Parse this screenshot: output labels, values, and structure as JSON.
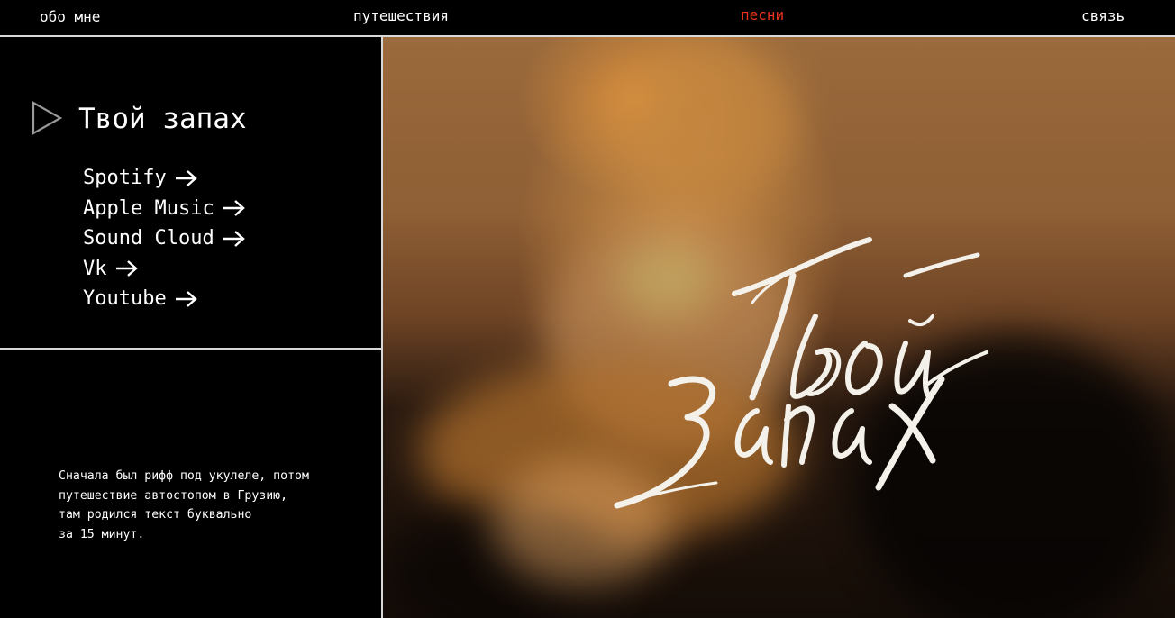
{
  "nav": {
    "about": "обо мне",
    "travel": "путешествия",
    "songs": "песни",
    "contact": "связь",
    "active_color": "#e8311d"
  },
  "song": {
    "title": "Твой запах",
    "play_icon": "play-triangle-icon",
    "links": [
      {
        "label": "Spotify",
        "icon": "arrow-right-icon"
      },
      {
        "label": "Apple Music",
        "icon": "arrow-right-icon"
      },
      {
        "label": "Sound Cloud",
        "icon": "arrow-right-icon"
      },
      {
        "label": "Vk",
        "icon": "arrow-right-icon"
      },
      {
        "label": "Youtube",
        "icon": "arrow-right-icon"
      }
    ],
    "description_lines": [
      "Сначала был рифф под укулеле, потом",
      "путешествие автостопом в Грузию,",
      "там родился текст буквально",
      "за 15 минут."
    ]
  },
  "cover": {
    "lettering": "Твой запах"
  }
}
